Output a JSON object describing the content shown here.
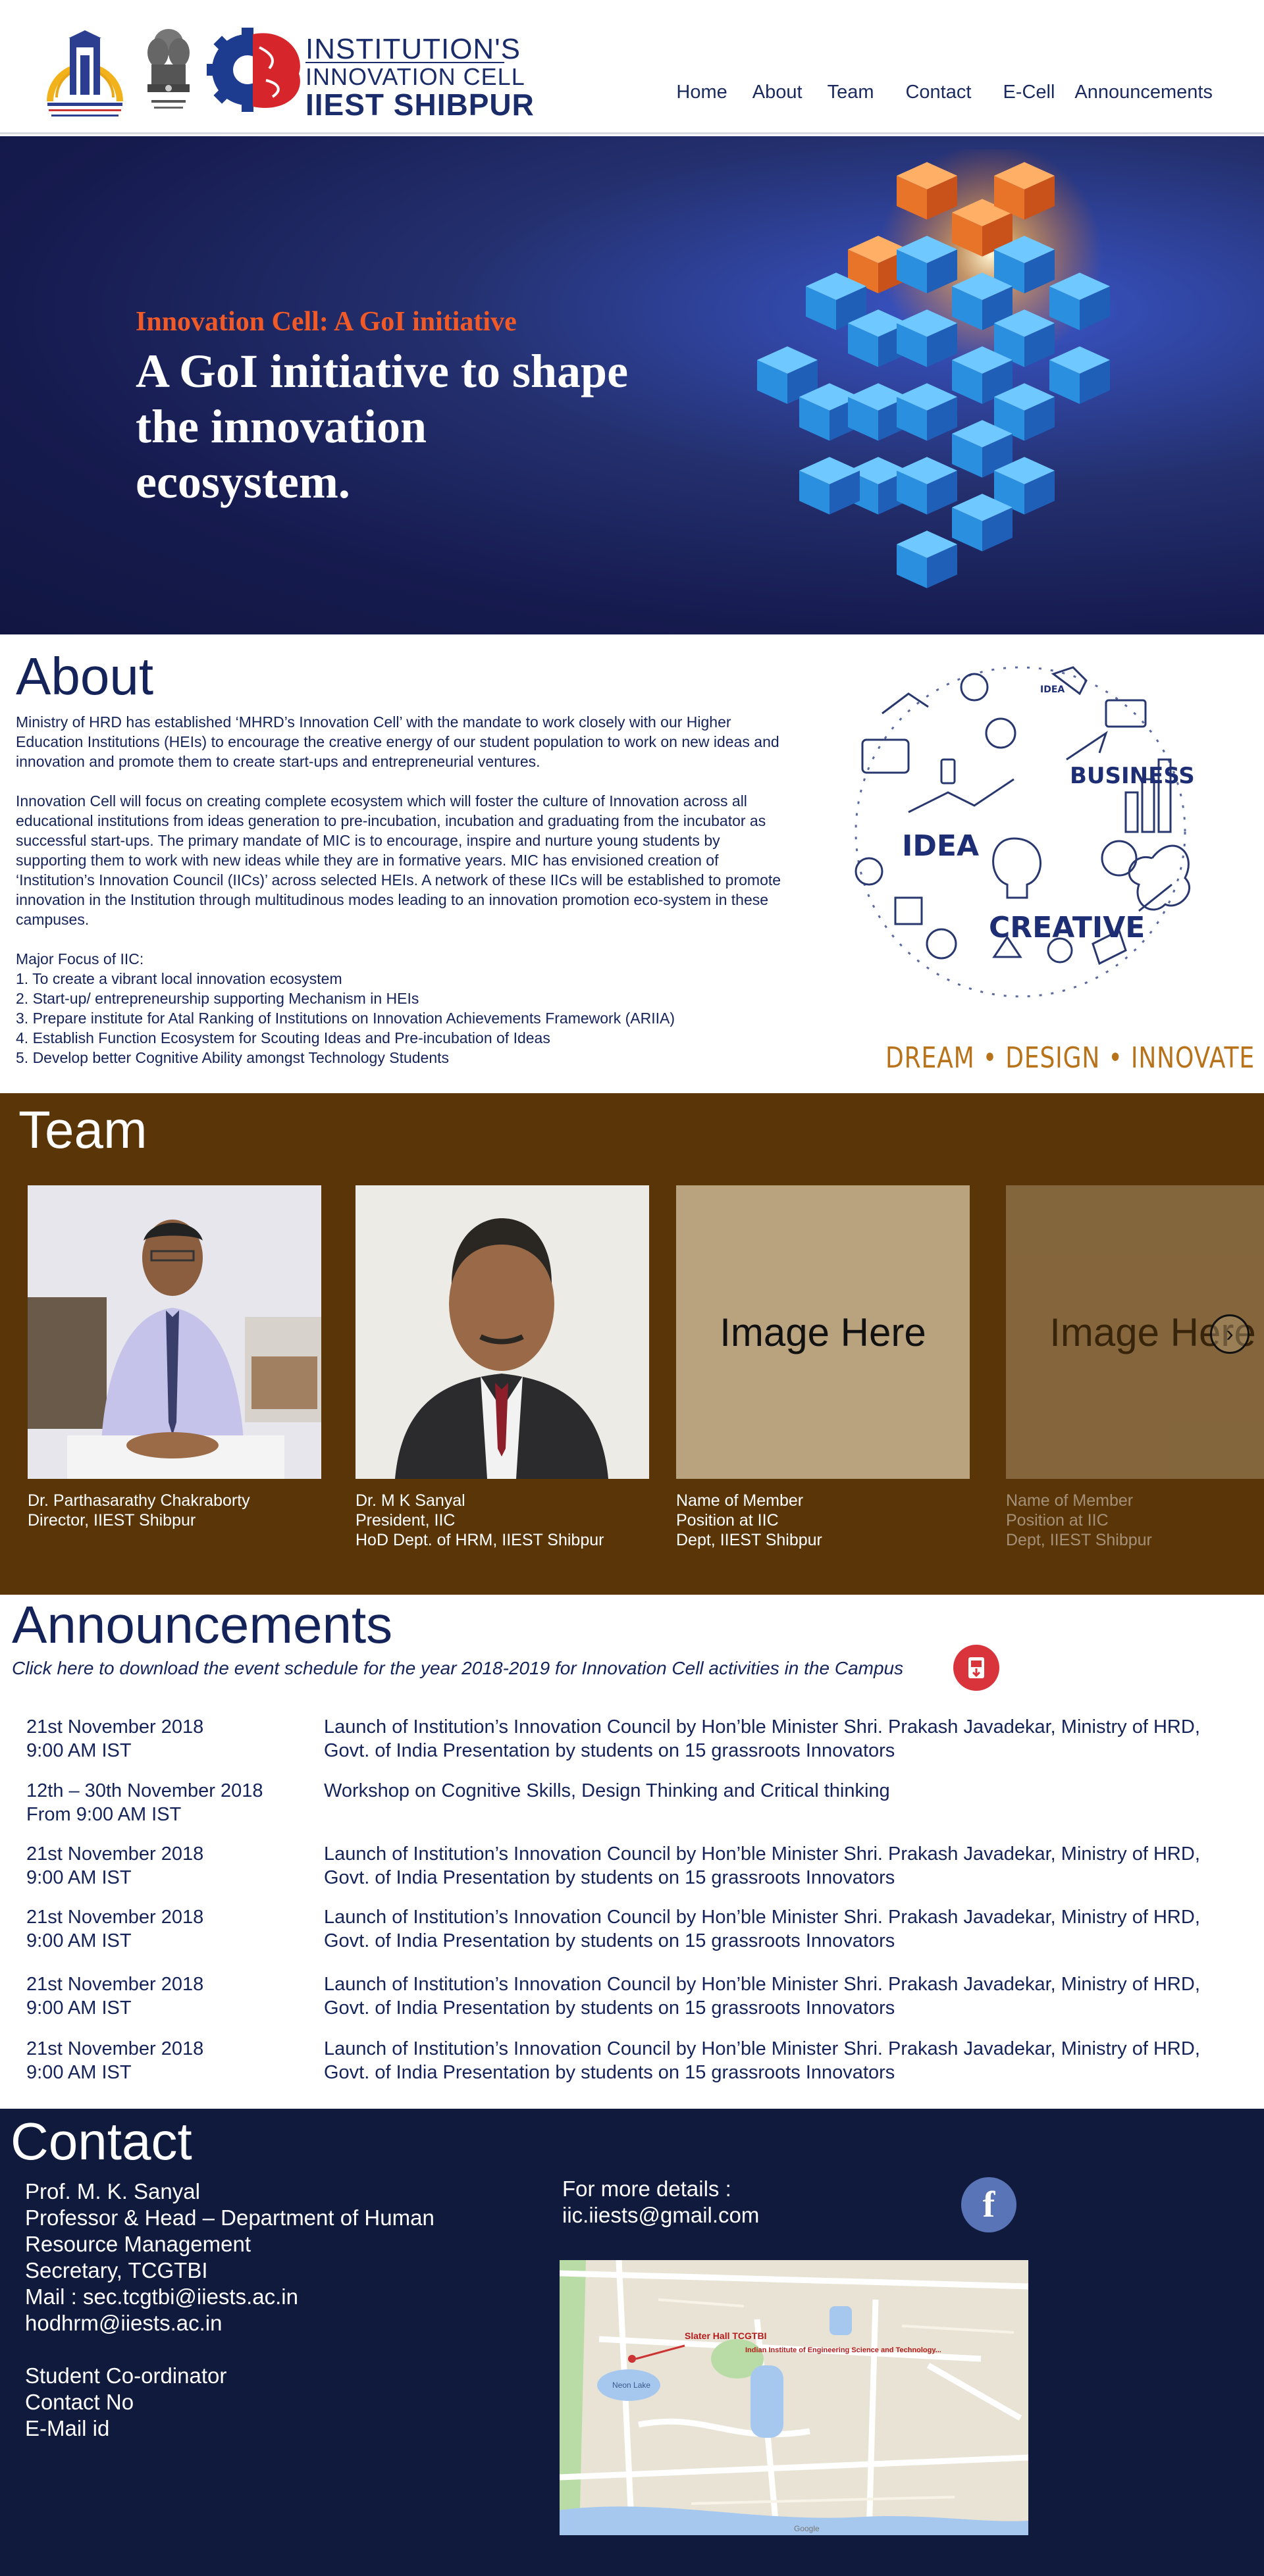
{
  "header": {
    "brand": {
      "line1": "INSTITUTION'S",
      "line2": "INNOVATION CELL",
      "line3": "IIEST SHIBPUR"
    },
    "nav": [
      "Home",
      "About",
      "Team",
      "Contact",
      "E-Cell",
      "Announcements"
    ]
  },
  "hero": {
    "kicker": "Innovation Cell: A GoI initiative",
    "title": "A GoI initiative to shape the innovation ecosystem."
  },
  "about": {
    "heading": "About",
    "paragraph1": "Ministry of HRD has established ‘MHRD’s Innovation Cell’ with the mandate to work closely with our Higher Education Institutions (HEIs) to encourage the creative energy of our student population to work on new ideas and innovation and promote them to create start-ups and entrepreneurial ventures.",
    "paragraph2": "Innovation Cell will focus on creating complete ecosystem which will foster the culture of Innovation across all educational institutions from ideas generation to pre-incubation, incubation and graduating from the incubator as successful start-ups. The primary mandate of MIC is to encourage, inspire and nurture young students by supporting them to work with new ideas while they are in formative years. MIC has envisioned creation of ‘Institution’s Innovation Council (IICs)’ across selected HEIs. A network of these IICs will be established to promote innovation in the Institution through multitudinous modes leading to an innovation promotion eco-system in these campuses.",
    "focus_title": "Major Focus of IIC:",
    "focus_items": [
      "1.  To create a vibrant local innovation ecosystem",
      "2.  Start-up/ entrepreneurship supporting Mechanism in HEIs",
      "3.  Prepare institute for Atal Ranking of Institutions on Innovation Achievements Framework (ARIIA)",
      "4.  Establish Function Ecosystem for Scouting Ideas and Pre-incubation of Ideas",
      "5.  Develop better Cognitive Ability amongst Technology Students"
    ],
    "art_words": {
      "business": "BUSINESS",
      "idea": "IDEA",
      "creative": "CREATIVE",
      "small_idea": "IDEA"
    },
    "tagline": "DREAM • DESIGN • INNOVATE"
  },
  "team": {
    "heading": "Team",
    "members": [
      {
        "name": "Dr. Parthasarathy Chakraborty",
        "role": "Director, IIEST Shibpur",
        "dept": ""
      },
      {
        "name": "Dr. M K Sanyal",
        "role": "President, IIC",
        "dept": "HoD Dept. of HRM, IIEST Shibpur"
      },
      {
        "name": "Name of Member",
        "role": "Position at IIC",
        "dept": "Dept, IIEST Shibpur",
        "placeholder": "Image Here"
      },
      {
        "name": "Name of Member",
        "role": "Position at IIC",
        "dept": "Dept, IIEST Shibpur",
        "placeholder": "Image Here"
      }
    ],
    "next_glyph": "›"
  },
  "announcements": {
    "heading": "Announcements",
    "download_text": "Click here to download the event schedule for the year 2018-2019 for Innovation Cell activities in the Campus",
    "items": [
      {
        "date": "21st November 2018",
        "time": "9:00 AM IST",
        "line1": "Launch of Institution’s Innovation Council by Hon’ble Minister Shri. Prakash Javadekar, Ministry of HRD,",
        "line2": "Govt. of India Presentation by students on 15 grassroots Innovators"
      },
      {
        "date": "12th – 30th November 2018",
        "time": "From 9:00 AM IST",
        "line1": "Workshop on Cognitive Skills, Design Thinking and Critical thinking",
        "line2": ""
      },
      {
        "date": "21st November 2018",
        "time": "9:00 AM IST",
        "line1": "Launch of Institution’s Innovation Council by Hon’ble Minister Shri. Prakash Javadekar, Ministry of HRD,",
        "line2": "Govt. of India Presentation by students on 15 grassroots Innovators"
      },
      {
        "date": "21st November 2018",
        "time": "9:00 AM IST",
        "line1": "Launch of Institution’s Innovation Council by Hon’ble Minister Shri. Prakash Javadekar, Ministry of HRD,",
        "line2": "Govt. of India Presentation by students on 15 grassroots Innovators"
      },
      {
        "date": "21st November 2018",
        "time": "9:00 AM IST",
        "line1": "Launch of Institution’s Innovation Council by Hon’ble Minister Shri. Prakash Javadekar, Ministry of HRD,",
        "line2": "Govt. of India Presentation by students on 15 grassroots Innovators"
      },
      {
        "date": "21st November 2018",
        "time": "9:00 AM IST",
        "line1": "Launch of Institution’s Innovation Council by Hon’ble Minister Shri. Prakash Javadekar, Ministry of HRD,",
        "line2": "Govt. of India Presentation by students on 15 grassroots Innovators"
      }
    ]
  },
  "contact": {
    "heading": "Contact",
    "lines": [
      "Prof. M. K. Sanyal",
      "Professor & Head – Department of Human",
      "Resource Management",
      "Secretary, TCGTBI",
      "Mail : sec.tcgtbi@iiests.ac.in",
      "hodhrm@iiests.ac.in"
    ],
    "student_lines": [
      "Student Co-ordinator",
      "Contact No",
      "E-Mail id"
    ],
    "more_label": "For more details :",
    "more_email": "iic.iiests@gmail.com",
    "facebook_glyph": "f",
    "map_labels": {
      "marker": "Slater Hall TCGTBI",
      "institute": "Indian Institute of Engineering Science and Technology...",
      "lake": "Neon Lake",
      "google": "Google"
    }
  },
  "colors": {
    "brand_navy": "#1b2c6b",
    "hero_kicker": "#f05a28",
    "team_bg": "#5a3507",
    "contact_bg": "#0f1a3d",
    "tagline": "#b8731a"
  }
}
